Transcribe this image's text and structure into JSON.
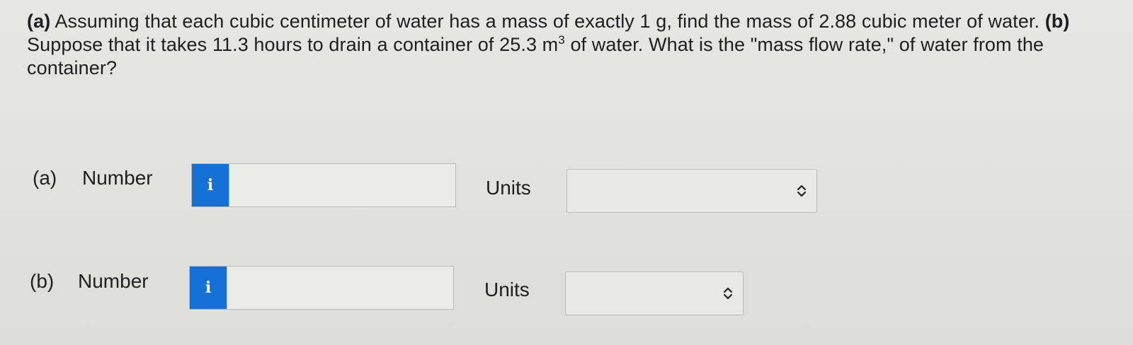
{
  "question": {
    "part_a_marker": "(a)",
    "part_a_text": "Assuming that each cubic centimeter of water has a mass of exactly 1 g, find the mass of 2.88 cubic meter of water.",
    "part_b_marker": "(b)",
    "part_b_text_pre": "Suppose that it takes 11.3 hours to drain a container of 25.3 m",
    "part_b_superscript": "3",
    "part_b_text_post": "of water. What is the \"mass flow rate,\" of water from the container?"
  },
  "answers": [
    {
      "part_label": "(a)",
      "number_label": "Number",
      "info_icon": "i",
      "number_value": "",
      "units_label": "Units",
      "units_selected": ""
    },
    {
      "part_label": "(b)",
      "number_label": "Number",
      "info_icon": "i",
      "number_value": "",
      "units_label": "Units",
      "units_selected": ""
    }
  ],
  "colors": {
    "info_button": "#1670d6",
    "background": "#e3e3e1"
  },
  "icons": {
    "info": "info-icon",
    "units_dropdown": "chevron-up-down-icon"
  }
}
